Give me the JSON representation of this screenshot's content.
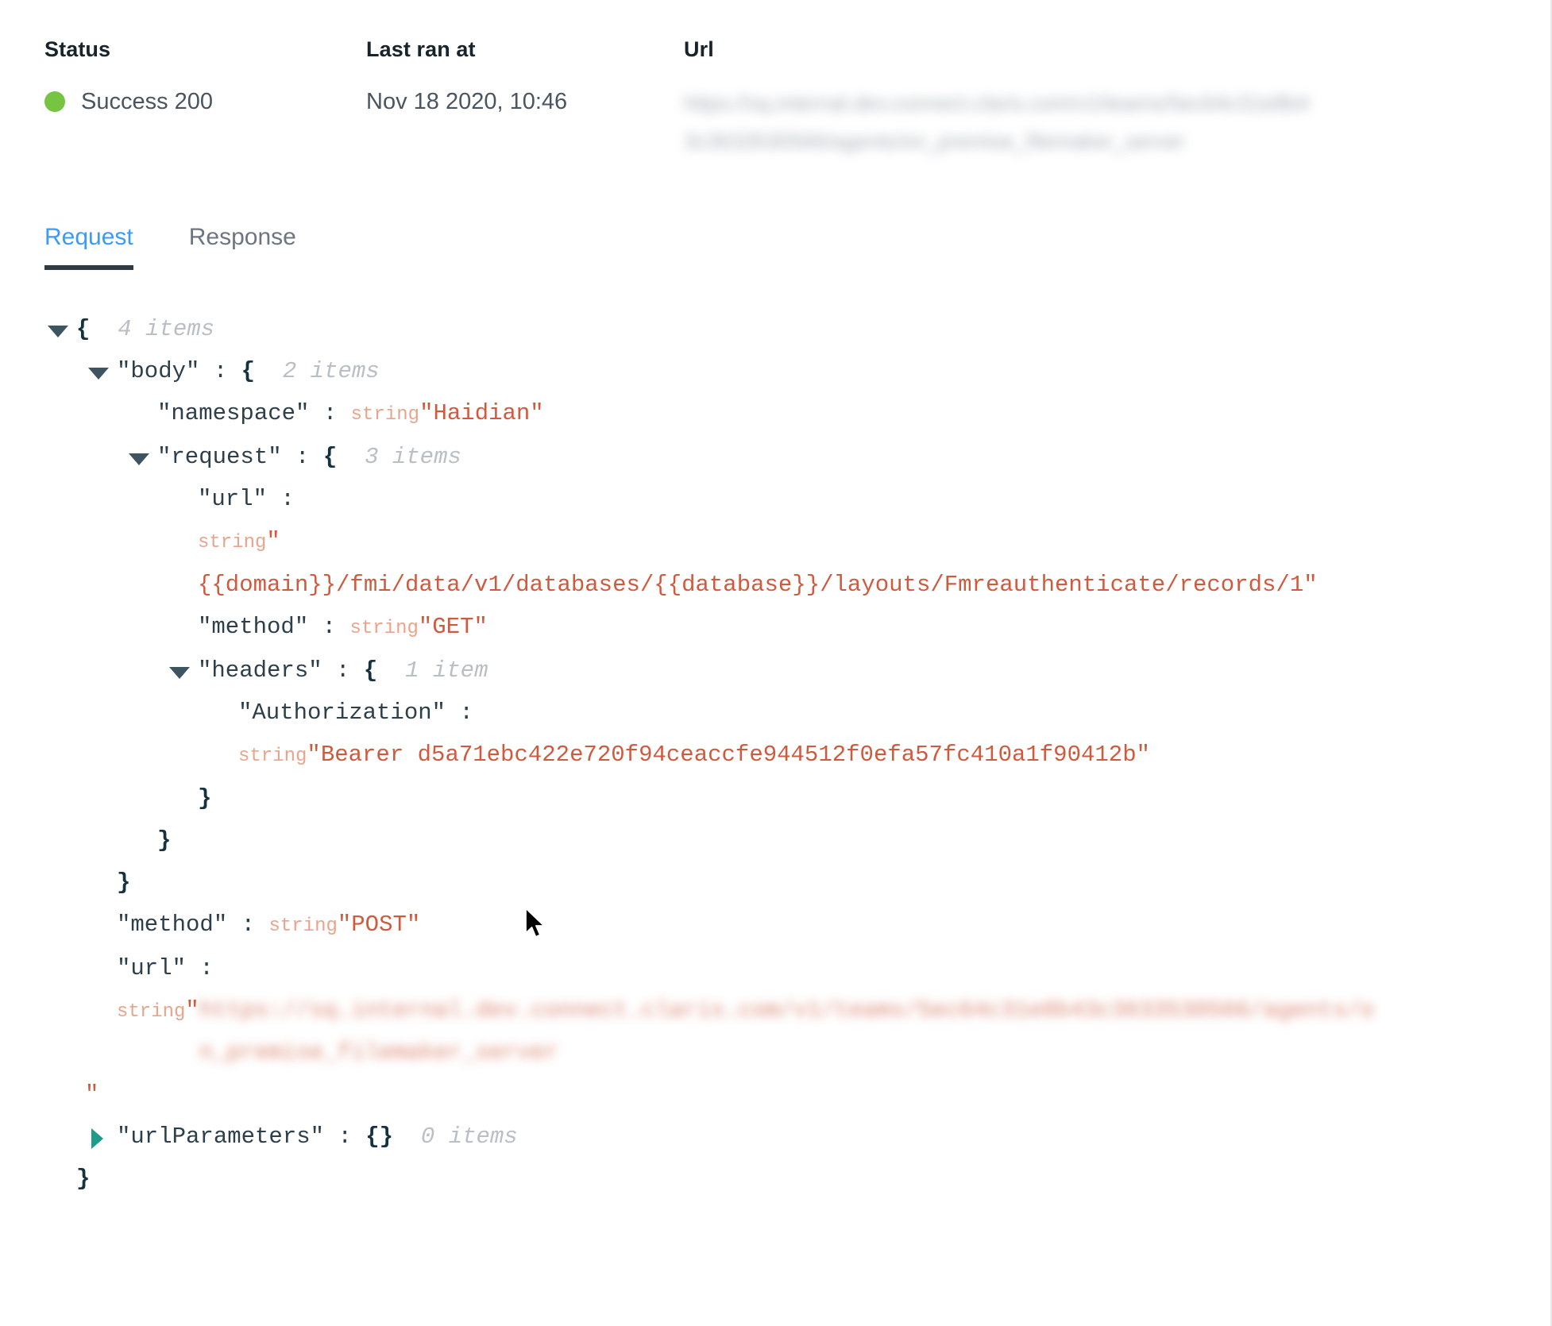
{
  "summary": {
    "status": {
      "label": "Status",
      "value": "Success 200",
      "dot_color": "#76c442"
    },
    "last_ran": {
      "label": "Last ran at",
      "value": "Nov 18 2020, 10:46"
    },
    "url": {
      "label": "Url",
      "value": "https://sq.internal.dev.connect.claris.com/v1/teams/5ec64c31e8b43c3633530566/agents/on_premise_filemaker_server"
    }
  },
  "tabs": {
    "items": [
      {
        "label": "Request",
        "active": true
      },
      {
        "label": "Response",
        "active": false
      }
    ],
    "active_color": "#3b9bf5",
    "underline_color": "#2f3b42"
  },
  "json_viewer": {
    "root_brace_open": "{",
    "root_count": "4 items",
    "root_brace_close": "}",
    "lines": {
      "body_key": "\"body\"",
      "body_count": "2 items",
      "namespace_key": "\"namespace\"",
      "namespace_type": "string",
      "namespace_value": "\"Haidian\"",
      "request_key": "\"request\"",
      "request_count": "3 items",
      "inner_url_key": "\"url\"",
      "inner_url_type": "string",
      "inner_url_quote": "\"",
      "inner_url_value": "{{domain}}/fmi/data/v1/databases/{{database}}/layouts/Fmreauthenticate/records/1\"",
      "inner_method_key": "\"method\"",
      "inner_method_type": "string",
      "inner_method_value": "\"GET\"",
      "headers_key": "\"headers\"",
      "headers_count": "1 item",
      "authorization_key": "\"Authorization\"",
      "authorization_type": "string",
      "authorization_value": "\"Bearer d5a71ebc422e720f94ceaccfe944512f0efa57fc410a1f90412b\"",
      "method_key": "\"method\"",
      "method_type": "string",
      "method_value": "\"POST\"",
      "url_key": "\"url\"",
      "url_type": "string",
      "url_quote_open": "\"",
      "url_value": "https://sq.internal.dev.connect.claris.com/v1/teams/5ec64c31e8b43c3633530566/agents/on_premise_filemaker_server",
      "url_quote_close": "\"",
      "urlparameters_key": "\"urlParameters\"",
      "urlparameters_braces": "{}",
      "urlparameters_count": "0 items",
      "colon": " : ",
      "brace_open": "{",
      "brace_close": "}"
    }
  },
  "colors": {
    "string_value": "#cf5b3e",
    "type_label": "#e8a58c",
    "key": "#2d3f4a",
    "count": "#b9bfc5",
    "collapsed_arrow": "#1d9c8a",
    "expanded_arrow": "#3e5561"
  }
}
